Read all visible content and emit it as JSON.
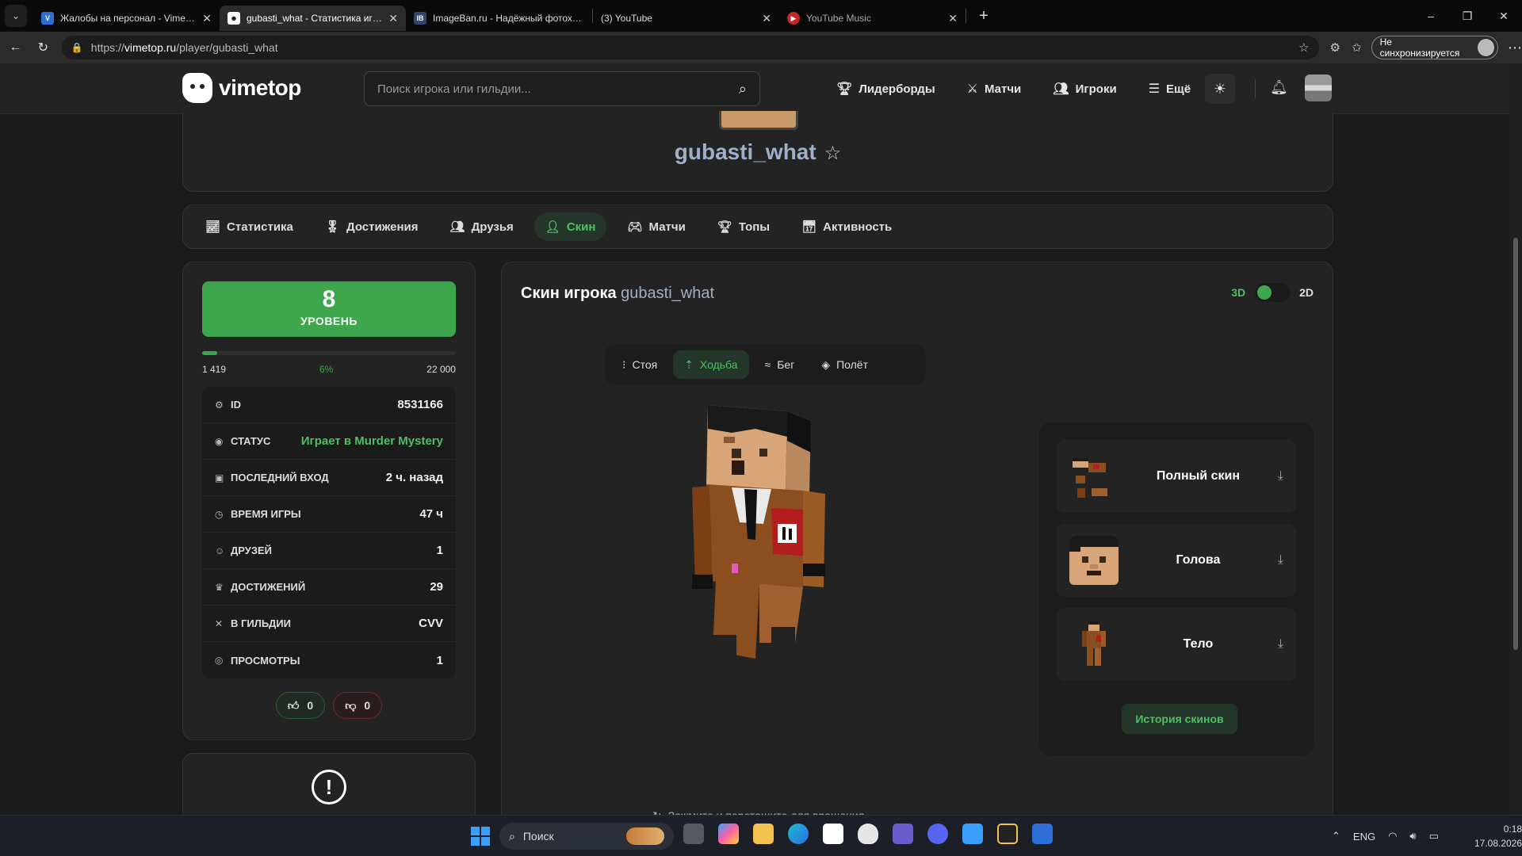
{
  "browser": {
    "tabs": [
      {
        "title": "Жалобы на персонал - VimeWorld",
        "icon": "vimeworld-icon",
        "active": false
      },
      {
        "title": "gubasti_what - Статистика игрока",
        "icon": "vimetop-icon",
        "active": true
      },
      {
        "title": "ImageBan.ru - Надёжный фотохостинг",
        "icon": "imageban-icon",
        "active": false
      },
      {
        "title": "(3) YouTube",
        "icon": "youtube-icon",
        "active": false
      },
      {
        "title": "YouTube Music",
        "icon": "youtube-music-icon",
        "active": false
      }
    ],
    "url_prefix": "https://",
    "url_host": "vimetop.ru",
    "url_path": "/player/gubasti_what",
    "sync_label": "Не синхронизируется"
  },
  "site": {
    "logo_text": "vimetop",
    "search_placeholder": "Поиск игрока или гильдии...",
    "nav": [
      {
        "label": "Лидерборды",
        "icon": "trophy-icon"
      },
      {
        "label": "Матчи",
        "icon": "swords-icon"
      },
      {
        "label": "Игроки",
        "icon": "users-icon"
      },
      {
        "label": "Ещё",
        "icon": "menu-icon"
      }
    ]
  },
  "profile": {
    "name": "gubasti_what",
    "tabs": [
      {
        "label": "Статистика",
        "icon": "chart-icon",
        "active": false
      },
      {
        "label": "Достижения",
        "icon": "medal-icon",
        "active": false
      },
      {
        "label": "Друзья",
        "icon": "users-icon",
        "active": false
      },
      {
        "label": "Скин",
        "icon": "user-icon",
        "active": true
      },
      {
        "label": "Матчи",
        "icon": "gamepad-icon",
        "active": false
      },
      {
        "label": "Топы",
        "icon": "trophy-icon",
        "active": false
      },
      {
        "label": "Активность",
        "icon": "calendar-icon",
        "active": false
      }
    ]
  },
  "stats": {
    "level": "8",
    "level_label": "УРОВЕНЬ",
    "xp_current": "1 419",
    "xp_percent": "6%",
    "xp_progress": 0.06,
    "xp_max": "22 000",
    "rows": [
      {
        "label": "ID",
        "value": "8531166",
        "icon": "gear-icon",
        "green": false
      },
      {
        "label": "СТАТУС",
        "value": "Играет в Murder Mystery",
        "icon": "rss-icon",
        "green": true
      },
      {
        "label": "ПОСЛЕДНИЙ ВХОД",
        "value": "2 ч. назад",
        "icon": "gamepad-icon",
        "green": false
      },
      {
        "label": "ВРЕМЯ ИГРЫ",
        "value": "47 ч",
        "icon": "clock-icon",
        "green": false
      },
      {
        "label": "ДРУЗЕЙ",
        "value": "1",
        "icon": "users-icon",
        "green": false
      },
      {
        "label": "ДОСТИЖЕНИЙ",
        "value": "29",
        "icon": "medal-icon",
        "green": false
      },
      {
        "label": "В ГИЛЬДИИ",
        "value": "CVV",
        "icon": "swords-icon",
        "green": false
      },
      {
        "label": "ПРОСМОТРЫ",
        "value": "1",
        "icon": "eye-icon",
        "green": false
      }
    ],
    "likes": "0",
    "dislikes": "0"
  },
  "skin": {
    "title": "Скин игрока",
    "player": "gubasti_what",
    "mode_3d": "3D",
    "mode_2d": "2D",
    "animations": [
      {
        "label": "Стоя",
        "icon": "stand-icon",
        "active": false
      },
      {
        "label": "Ходьба",
        "icon": "walk-icon",
        "active": true
      },
      {
        "label": "Бег",
        "icon": "run-icon",
        "active": false
      },
      {
        "label": "Полёт",
        "icon": "layers-icon",
        "active": false
      }
    ],
    "downloads": [
      {
        "label": "Полный скин",
        "name": "full-skin"
      },
      {
        "label": "Голова",
        "name": "head"
      },
      {
        "label": "Тело",
        "name": "body"
      }
    ],
    "history_label": "История скинов",
    "rotate_hint": "Зажмите и перетащите для вращения"
  },
  "taskbar": {
    "search_label": "Поиск",
    "lang": "ENG",
    "time": "0:18",
    "date": "17.08.2026"
  }
}
